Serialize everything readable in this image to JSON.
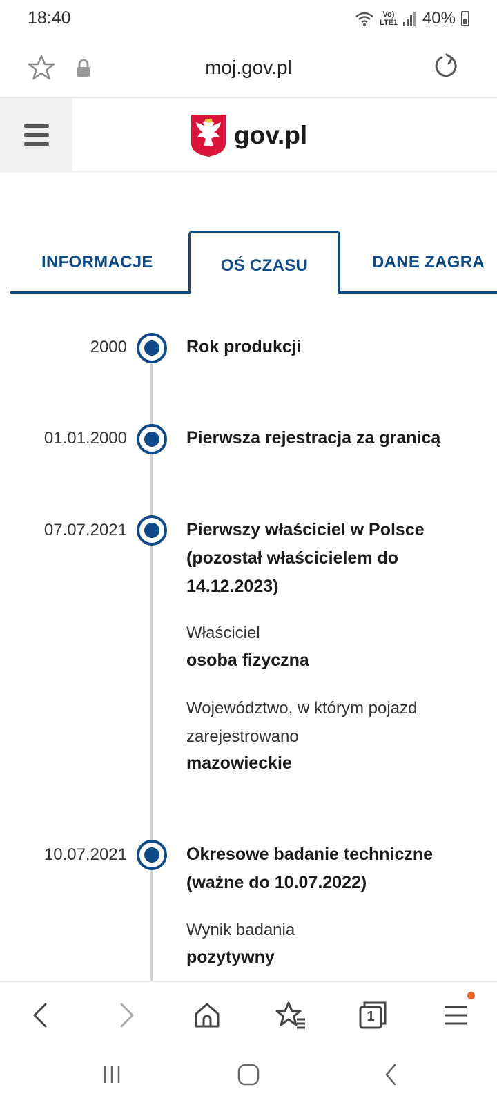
{
  "status_bar": {
    "time": "18:40",
    "network_label": "Vo) LTE1",
    "battery": "40%"
  },
  "browser": {
    "url": "moj.gov.pl"
  },
  "site_header": {
    "logo_text": "gov.pl"
  },
  "tabs": [
    {
      "label": "INFORMACJE",
      "active": false
    },
    {
      "label": "OŚ CZASU",
      "active": true
    },
    {
      "label": "DANE ZAGRA",
      "active": false
    }
  ],
  "timeline": [
    {
      "date": "2000",
      "title": "Rok produkcji"
    },
    {
      "date": "01.01.2000",
      "title": "Pierwsza rejestracja za granicą"
    },
    {
      "date": "07.07.2021",
      "title": "Pierwszy właściciel w Polsce (pozostał właścicielem do 14.12.2023)",
      "details": [
        {
          "label": "Właściciel",
          "value": "osoba fizyczna"
        },
        {
          "label": "Województwo, w którym pojazd zarejestrowano",
          "value": "mazowieckie"
        }
      ]
    },
    {
      "date": "10.07.2021",
      "title": "Okresowe badanie techniczne (ważne do 10.07.2022)",
      "details": [
        {
          "label": "Wynik badania",
          "value": "pozytywny"
        }
      ]
    }
  ],
  "bottom_nav": {
    "tab_count": "1"
  },
  "colors": {
    "accent": "#0c4a8a",
    "timeline_line": "#cfcfcf",
    "notification": "#e8661f",
    "emblem_red": "#dc143c"
  }
}
